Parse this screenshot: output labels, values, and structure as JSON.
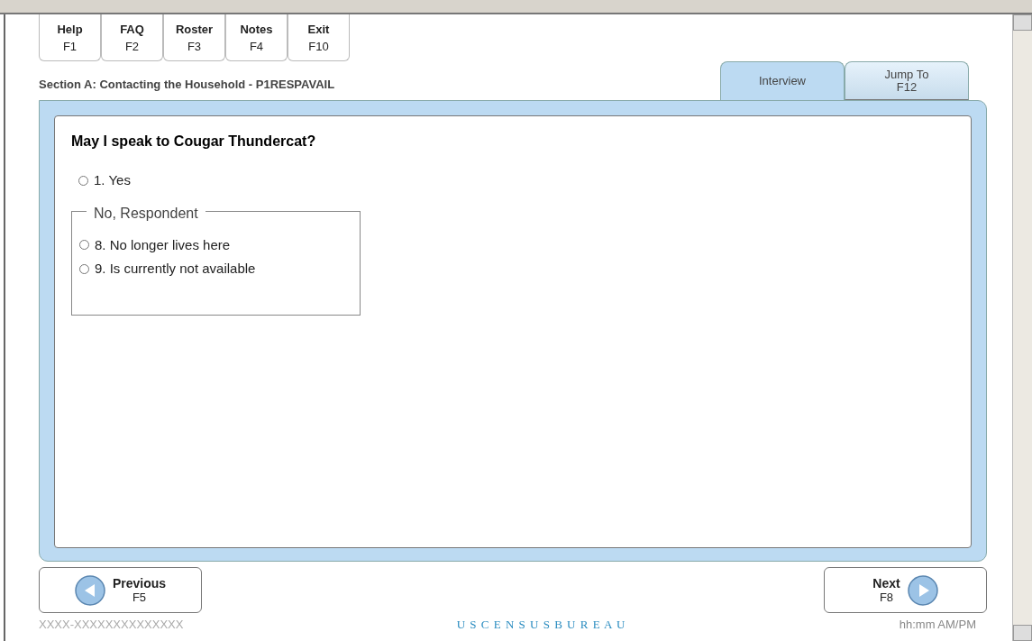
{
  "function_keys": [
    {
      "label": "Help",
      "key": "F1"
    },
    {
      "label": "FAQ",
      "key": "F2"
    },
    {
      "label": "Roster",
      "key": "F3"
    },
    {
      "label": "Notes",
      "key": "F4"
    },
    {
      "label": "Exit",
      "key": "F10"
    }
  ],
  "section_title": "Section A: Contacting the Household - P1RESPAVAIL",
  "tabs": [
    {
      "label": "Interview",
      "selected": true
    },
    {
      "label": "Jump To",
      "key": "F12",
      "selected": false
    }
  ],
  "question": "May I speak to Cougar Thundercat?",
  "options": [
    {
      "label": "1. Yes",
      "checked": false
    }
  ],
  "group": {
    "legend": "No, Respondent",
    "options": [
      {
        "label": "8. No longer lives here",
        "checked": false
      },
      {
        "label": "9. Is currently not available",
        "checked": false
      }
    ]
  },
  "previous": {
    "label": "Previous",
    "key": "F5"
  },
  "next": {
    "label": "Next",
    "key": "F8"
  },
  "footer": {
    "case_id": "XXXX-XXXXXXXXXXXXXX",
    "logo": "U S C E N S U S B U R E A U",
    "time": "hh:mm AM/PM"
  }
}
